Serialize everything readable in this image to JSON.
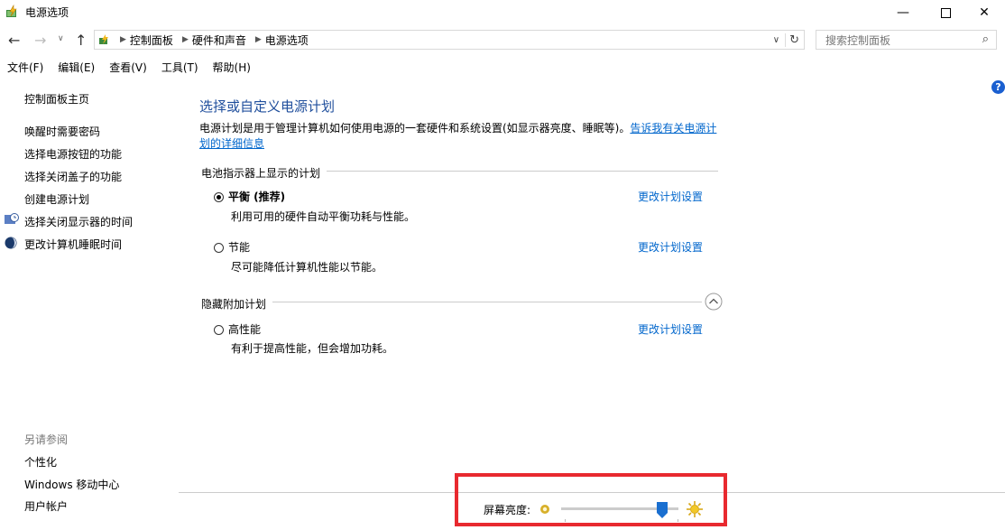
{
  "window": {
    "title": "电源选项"
  },
  "address": {
    "crumbs": [
      "控制面板",
      "硬件和声音",
      "电源选项"
    ],
    "search_placeholder": "搜索控制面板"
  },
  "menu": [
    "文件(F)",
    "编辑(E)",
    "查看(V)",
    "工具(T)",
    "帮助(H)"
  ],
  "sidebar": {
    "home": "控制面板主页",
    "links": [
      "唤醒时需要密码",
      "选择电源按钮的功能",
      "选择关闭盖子的功能",
      "创建电源计划",
      "选择关闭显示器的时间",
      "更改计算机睡眠时间"
    ],
    "see_also_title": "另请参阅",
    "see_also": [
      "个性化",
      "Windows 移动中心",
      "用户帐户"
    ]
  },
  "main": {
    "title": "选择或自定义电源计划",
    "desc_text": "电源计划是用于管理计算机如何使用电源的一套硬件和系统设置(如显示器亮度、睡眠等)。",
    "desc_link": "告诉我有关电源计划的详细信息",
    "section_battery": "电池指示器上显示的计划",
    "section_hidden": "隐藏附加计划",
    "plans": [
      {
        "name": "平衡 (推荐)",
        "desc": "利用可用的硬件自动平衡功耗与性能。",
        "link": "更改计划设置",
        "selected": true
      },
      {
        "name": "节能",
        "desc": "尽可能降低计算机性能以节能。",
        "link": "更改计划设置",
        "selected": false
      },
      {
        "name": "高性能",
        "desc": "有利于提高性能，但会增加功耗。",
        "link": "更改计划设置",
        "selected": false
      }
    ]
  },
  "brightness": {
    "label": "屏幕亮度:",
    "value_fraction": 0.86
  },
  "colors": {
    "link": "#0066cc",
    "title": "#1f4e9c",
    "highlight": "#e8292f",
    "slider": "#1a6fd0"
  }
}
